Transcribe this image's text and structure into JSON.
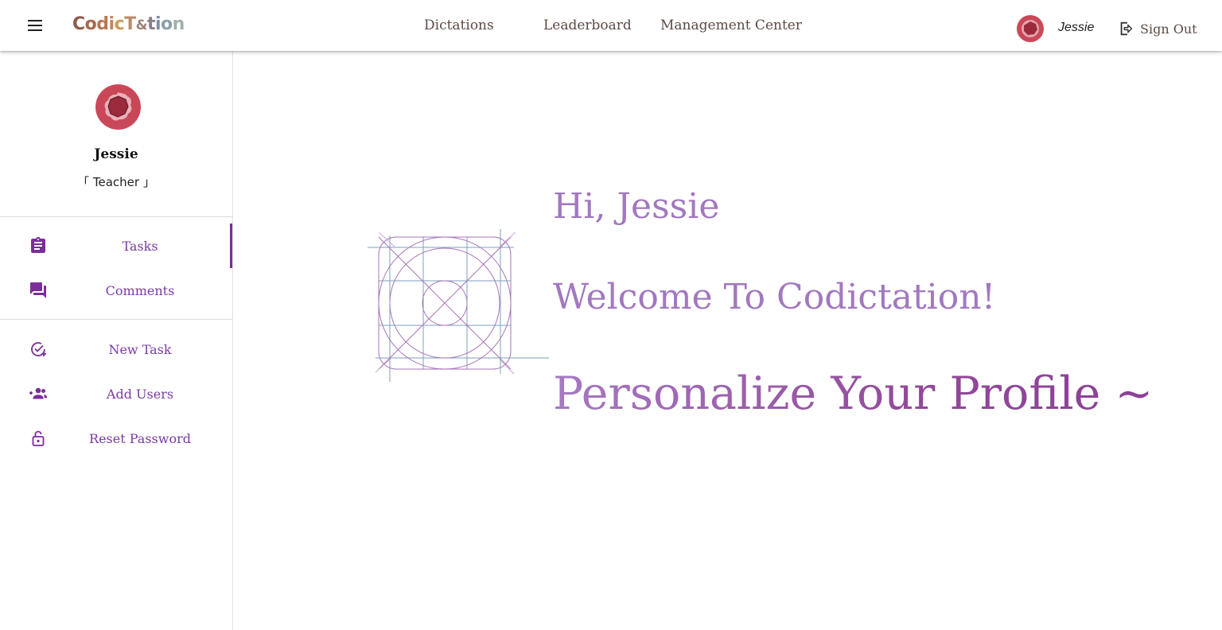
{
  "app": {
    "logo_letters": [
      "C",
      "o",
      "d",
      "i",
      "c",
      "T",
      "&",
      "t",
      "i",
      "o",
      "n"
    ],
    "logo_colors": [
      "#8e5c49",
      "#a5674f",
      "#b77553",
      "#c48655",
      "#c99a5b",
      "#b88d6a",
      "#9b8276",
      "#8a7f88",
      "#7e8ea0",
      "#8aa0a8",
      "#9cb3a6"
    ]
  },
  "nav": {
    "links": [
      {
        "label": "Dictations"
      },
      {
        "label": "Leaderboard"
      },
      {
        "label": "Management Center"
      }
    ],
    "user_name": "Jessie",
    "signout_label": "Sign Out"
  },
  "sidebar": {
    "name": "Jessie",
    "role": "「 Teacher 」",
    "items": [
      {
        "label": "Tasks",
        "icon": "clipboard-icon",
        "active": true
      },
      {
        "label": "Comments",
        "icon": "chat-icon",
        "active": false
      },
      {
        "label": "New Task",
        "icon": "add-task-icon",
        "active": false
      },
      {
        "label": "Add Users",
        "icon": "add-users-icon",
        "active": false
      },
      {
        "label": "Reset Password",
        "icon": "lock-icon",
        "active": false
      }
    ]
  },
  "main": {
    "greeting": "Hi, Jessie",
    "welcome": "Welcome To Codictation!",
    "personalize": "Personalize Your Profile ~"
  },
  "colors": {
    "accent": "#7b2d9a",
    "nav_text": "#5a4a44",
    "heading": "#a278bf",
    "avatar_red": "#c94858"
  }
}
